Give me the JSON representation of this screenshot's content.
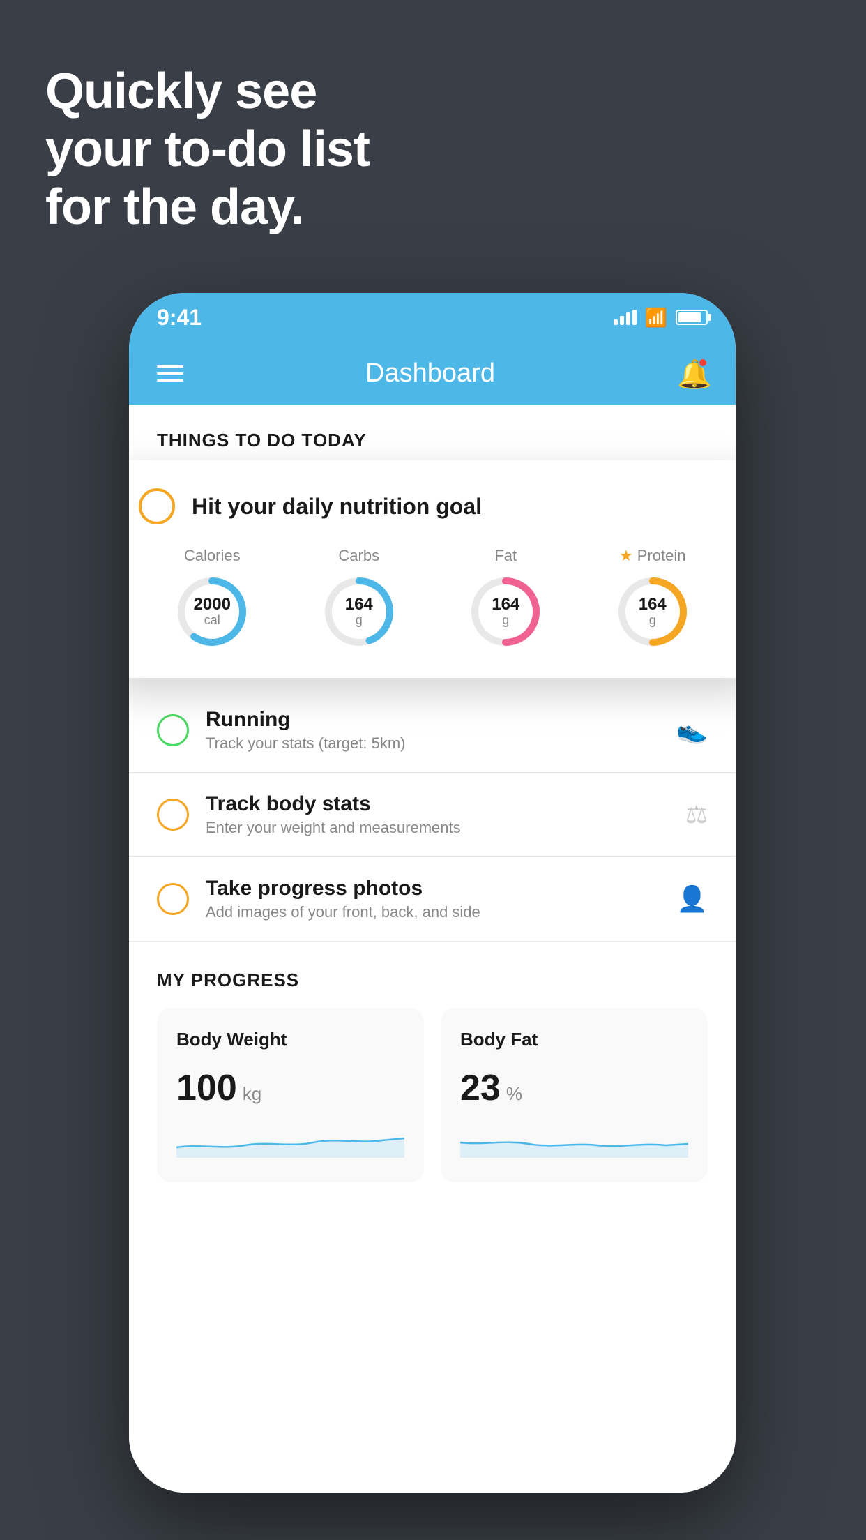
{
  "hero": {
    "line1": "Quickly see",
    "line2": "your to-do list",
    "line3": "for the day."
  },
  "status_bar": {
    "time": "9:41"
  },
  "header": {
    "title": "Dashboard"
  },
  "things_section": {
    "title": "THINGS TO DO TODAY"
  },
  "floating_card": {
    "title": "Hit your daily nutrition goal",
    "nutrition": [
      {
        "label": "Calories",
        "value": "2000",
        "unit": "cal",
        "color": "#4db8e8",
        "percent": 60,
        "star": false
      },
      {
        "label": "Carbs",
        "value": "164",
        "unit": "g",
        "color": "#4db8e8",
        "percent": 45,
        "star": false
      },
      {
        "label": "Fat",
        "value": "164",
        "unit": "g",
        "color": "#f06292",
        "percent": 55,
        "star": false
      },
      {
        "label": "Protein",
        "value": "164",
        "unit": "g",
        "color": "#f5a623",
        "percent": 50,
        "star": true
      }
    ]
  },
  "todo_items": [
    {
      "title": "Running",
      "subtitle": "Track your stats (target: 5km)",
      "circle_color": "green",
      "icon": "👟"
    },
    {
      "title": "Track body stats",
      "subtitle": "Enter your weight and measurements",
      "circle_color": "yellow",
      "icon": "⚖"
    },
    {
      "title": "Take progress photos",
      "subtitle": "Add images of your front, back, and side",
      "circle_color": "yellow",
      "icon": "👤"
    }
  ],
  "progress": {
    "title": "MY PROGRESS",
    "cards": [
      {
        "title": "Body Weight",
        "value": "100",
        "unit": "kg"
      },
      {
        "title": "Body Fat",
        "value": "23",
        "unit": "%"
      }
    ]
  }
}
